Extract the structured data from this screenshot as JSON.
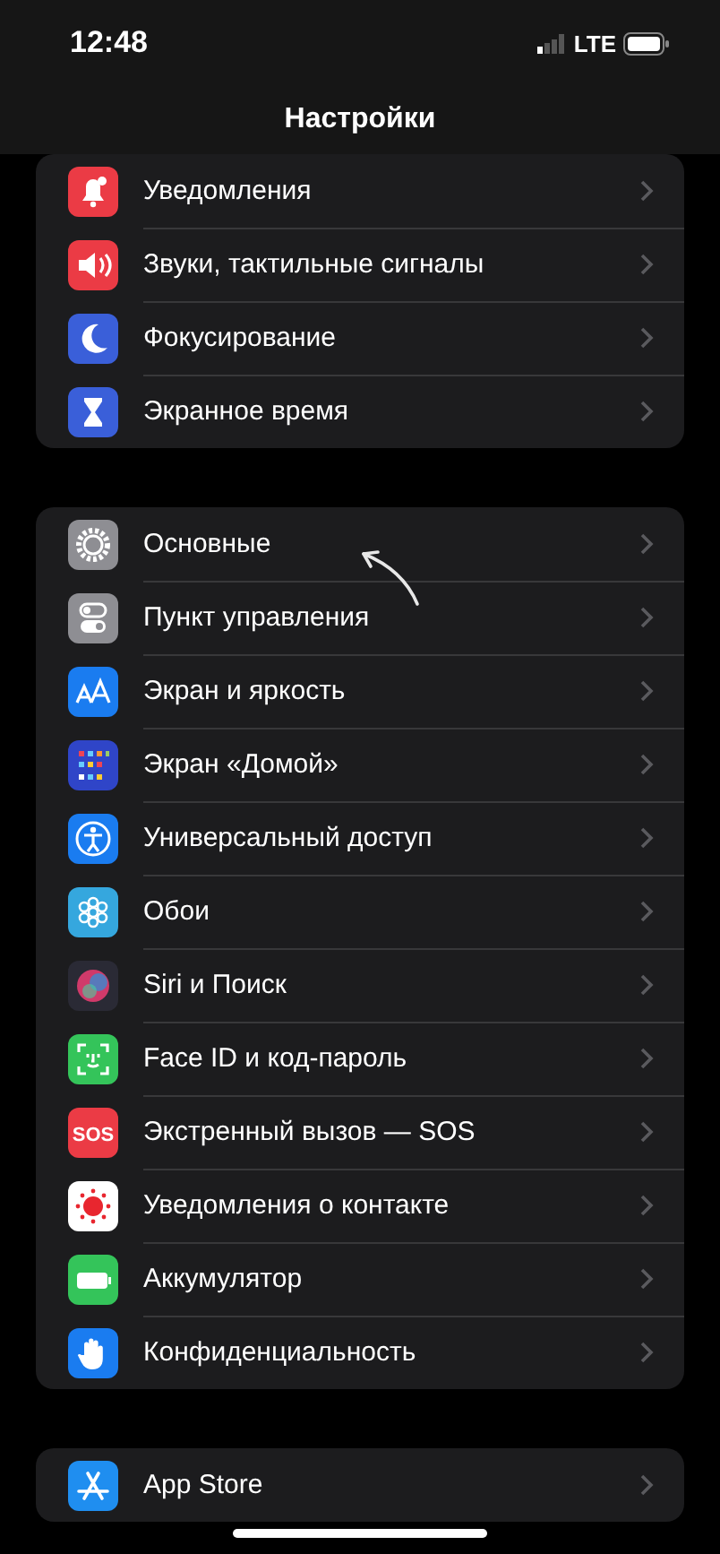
{
  "status_bar": {
    "time": "12:48",
    "network": "LTE"
  },
  "title": "Настройки",
  "groups": [
    {
      "items": [
        {
          "label": "Уведомления",
          "kind": "bell",
          "color": "#eb3b45"
        },
        {
          "label": "Звуки, тактильные сигналы",
          "kind": "speaker",
          "color": "#eb3b45"
        },
        {
          "label": "Фокусирование",
          "kind": "moon",
          "color": "#3a5fd9"
        },
        {
          "label": "Экранное время",
          "kind": "hourglass",
          "color": "#3a5fd9"
        }
      ]
    },
    {
      "items": [
        {
          "label": "Основные",
          "kind": "gear",
          "color": "#8e8e93"
        },
        {
          "label": "Пункт управления",
          "kind": "toggles",
          "color": "#8e8e93"
        },
        {
          "label": "Экран и яркость",
          "kind": "textsize",
          "color": "#1a7cf0"
        },
        {
          "label": "Экран «Домой»",
          "kind": "grid",
          "color": "#2f45c8"
        },
        {
          "label": "Универсальный доступ",
          "kind": "person",
          "color": "#1a7cf0"
        },
        {
          "label": "Обои",
          "kind": "flower",
          "color": "#35a7de"
        },
        {
          "label": "Siri и Поиск",
          "kind": "orb",
          "color": "#2a2a35"
        },
        {
          "label": "Face ID и код-пароль",
          "kind": "face",
          "color": "#34c45a"
        },
        {
          "label": "Экстренный вызов — SOS",
          "kind": "badge",
          "badge": "SOS",
          "color": "#eb3b45"
        },
        {
          "label": "Уведомления о контакте",
          "kind": "sun",
          "color": "#ffffff"
        },
        {
          "label": "Аккумулятор",
          "kind": "battery",
          "color": "#34c45a"
        },
        {
          "label": "Конфиденциальность",
          "kind": "hand",
          "color": "#1a7cf0"
        }
      ]
    },
    {
      "items": [
        {
          "label": "App Store",
          "kind": "appstore",
          "color": "#1f8ef0"
        }
      ]
    }
  ]
}
